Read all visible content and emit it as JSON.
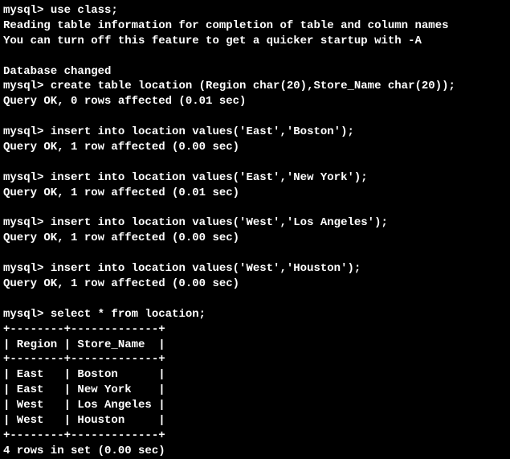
{
  "prompt": "mysql> ",
  "cmd1": "use class;",
  "msg1a": "Reading table information for completion of table and column names",
  "msg1b": "You can turn off this feature to get a quicker startup with -A",
  "msg1c": "Database changed",
  "cmd2": "create table location (Region char(20),Store_Name char(20));",
  "msg2": "Query OK, 0 rows affected (0.01 sec)",
  "cmd3": "insert into location values('East','Boston');",
  "msg3": "Query OK, 1 row affected (0.00 sec)",
  "cmd4": "insert into location values('East','New York');",
  "msg4": "Query OK, 1 row affected (0.01 sec)",
  "cmd5": "insert into location values('West','Los Angeles');",
  "msg5": "Query OK, 1 row affected (0.00 sec)",
  "cmd6": "insert into location values('West','Houston');",
  "msg6": "Query OK, 1 row affected (0.00 sec)",
  "cmd7": "select * from location;",
  "table": {
    "border": "+--------+-------------+",
    "header": "| Region | Store_Name  |",
    "row1": "| East   | Boston      |",
    "row2": "| East   | New York    |",
    "row3": "| West   | Los Angeles |",
    "row4": "| West   | Houston     |"
  },
  "footer": "4 rows in set (0.00 sec)"
}
